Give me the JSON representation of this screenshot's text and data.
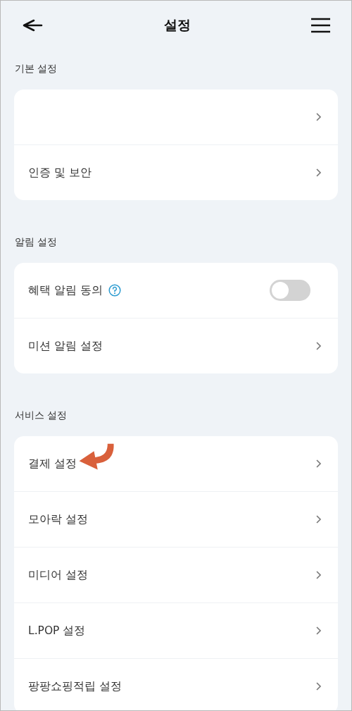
{
  "header": {
    "title": "설정"
  },
  "sections": [
    {
      "title": "기본 설정",
      "items": [
        {
          "kind": "link"
        },
        {
          "kind": "link",
          "label": "인증 및 보안"
        }
      ]
    },
    {
      "title": "알림 설정",
      "items": [
        {
          "kind": "toggle",
          "label": "혜택 알림 동의",
          "help": true,
          "on": false
        },
        {
          "kind": "link",
          "label": "미션 알림 설정"
        }
      ]
    },
    {
      "title": "서비스 설정",
      "items": [
        {
          "kind": "link",
          "label": "결제 설정",
          "pointer": true
        },
        {
          "kind": "link",
          "label": "모아락 설정"
        },
        {
          "kind": "link",
          "label": "미디어 설정"
        },
        {
          "kind": "link",
          "label": "L.POP 설정"
        },
        {
          "kind": "link",
          "label": "팡팡쇼핑적립 설정"
        }
      ]
    }
  ]
}
